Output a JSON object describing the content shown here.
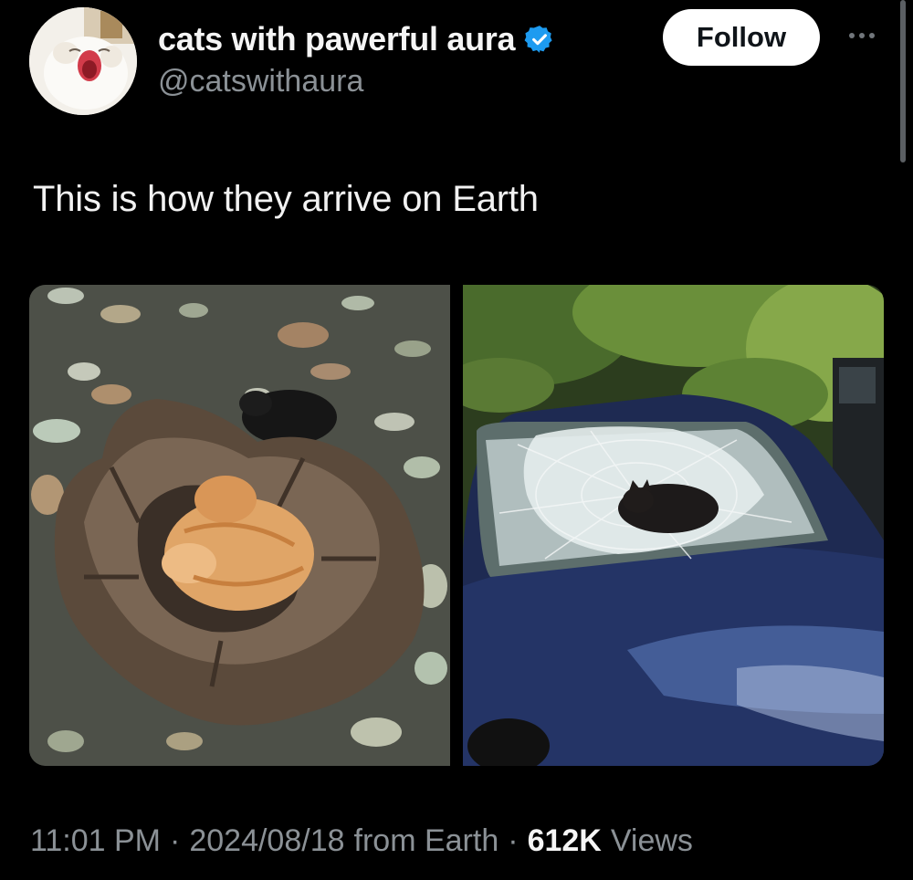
{
  "author": {
    "display_name": "cats with pawerful aura",
    "handle": "@catswithaura",
    "verified": true,
    "avatar_icon": "screaming-cat-avatar"
  },
  "actions": {
    "follow_label": "Follow",
    "more_icon": "more-options-icon"
  },
  "tweet": {
    "text": "This is how they arrive on Earth",
    "media": [
      {
        "name": "orange-cat-in-tree-stump-photo"
      },
      {
        "name": "black-cat-in-smashed-windshield-photo"
      }
    ]
  },
  "meta": {
    "time": "11:01 PM",
    "separator": "·",
    "date": "2024/08/18",
    "source": "from Earth",
    "views_count": "612K",
    "views_label": "Views"
  },
  "colors": {
    "background": "#000000",
    "verified_blue": "#1d9bf0",
    "secondary_text": "#8b9196",
    "follow_bg": "#ffffff"
  }
}
